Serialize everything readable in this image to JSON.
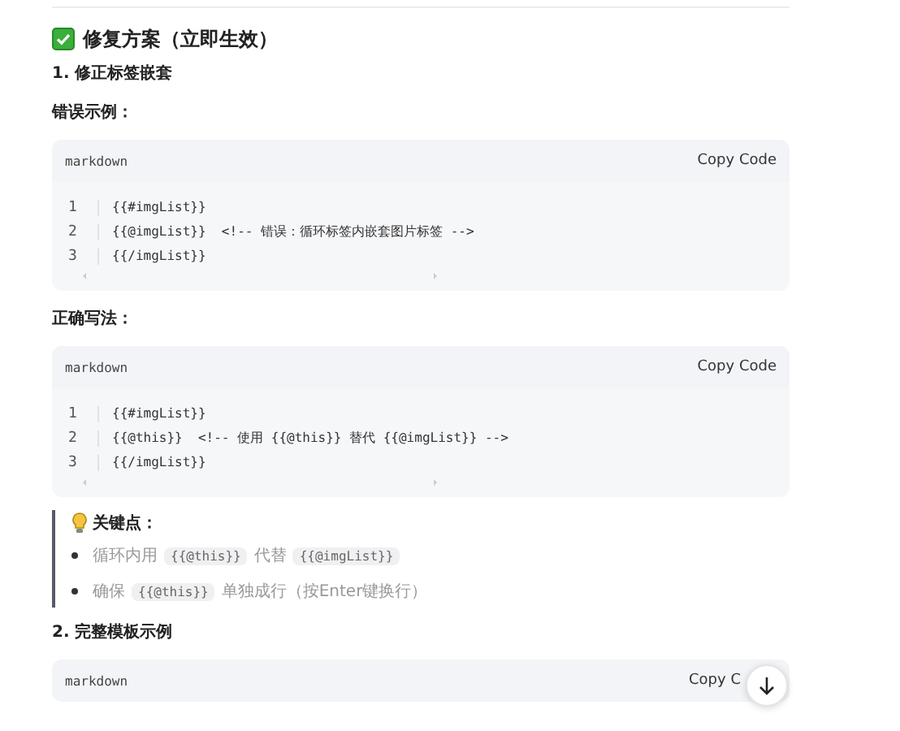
{
  "section_title": {
    "text": "修复方案（立即生效）"
  },
  "blocks": [
    {
      "kind": "heading",
      "text": "1. 修正标签嵌套"
    },
    {
      "kind": "label",
      "text": "错误示例："
    },
    {
      "kind": "code",
      "language": "markdown",
      "copy": "Copy Code",
      "lines": [
        {
          "number": "1",
          "text": "{{#imgList}}"
        },
        {
          "number": "2",
          "text": "{{@imgList}}  <!-- 错误：循环标签内嵌套图片标签 -->"
        },
        {
          "number": "3",
          "text": "{{/imgList}}"
        }
      ]
    },
    {
      "kind": "label",
      "text": "正确写法："
    },
    {
      "kind": "code",
      "language": "markdown",
      "copy": "Copy Code",
      "lines": [
        {
          "number": "1",
          "text": "{{#imgList}}"
        },
        {
          "number": "2",
          "text": "{{@this}}  <!-- 使用 {{@this}} 替代 {{@imgList}} -->"
        },
        {
          "number": "3",
          "text": "{{/imgList}}"
        }
      ]
    },
    {
      "kind": "quote",
      "title": "关键点：",
      "items": [
        [
          {
            "kind": "text",
            "text": "循环内用"
          },
          {
            "kind": "code",
            "text": "{{@this}}"
          },
          {
            "kind": "text",
            "text": "代替"
          },
          {
            "kind": "code",
            "text": "{{@imgList}}"
          }
        ],
        [
          {
            "kind": "text",
            "text": "确保"
          },
          {
            "kind": "code",
            "text": "{{@this}}"
          },
          {
            "kind": "text",
            "text": "单独成行（按Enter键换行）"
          }
        ]
      ]
    },
    {
      "kind": "heading",
      "text": "2. 完整模板示例"
    },
    {
      "kind": "code",
      "language": "markdown",
      "copy": "Copy C"
    }
  ]
}
